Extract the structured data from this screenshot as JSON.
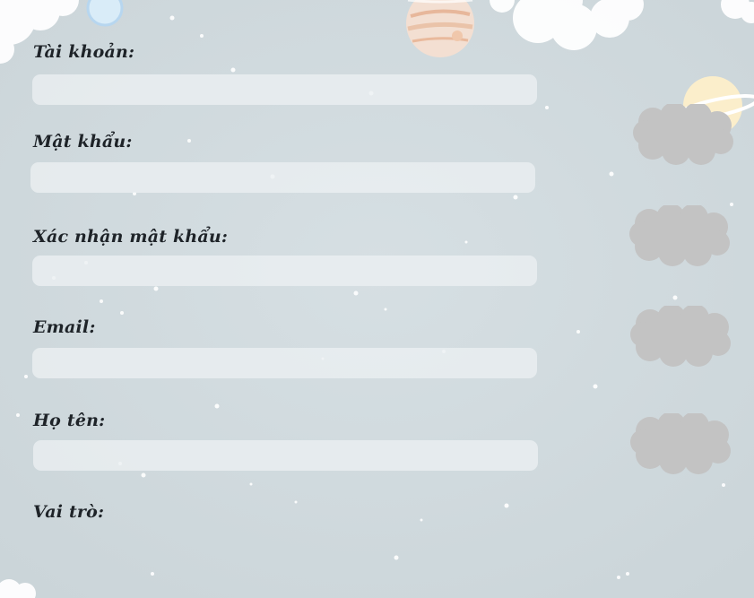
{
  "form": {
    "fields": [
      {
        "label": "Tài khoản:",
        "value": "",
        "placeholder": ""
      },
      {
        "label": "Mật khẩu:",
        "value": "",
        "placeholder": ""
      },
      {
        "label": "Xác nhận mật khẩu:",
        "value": "",
        "placeholder": ""
      },
      {
        "label": "Email:",
        "value": "",
        "placeholder": ""
      },
      {
        "label": "Họ tên:",
        "value": "",
        "placeholder": ""
      }
    ],
    "role_label": "Vai trò:"
  },
  "icons": {
    "side_clouds": [
      "cloud-icon",
      "cloud-icon",
      "cloud-icon",
      "cloud-icon"
    ],
    "decor": [
      "planet-icon",
      "ringed-planet-icon",
      "moon-icon",
      "cloud-icon"
    ]
  },
  "colors": {
    "background": "#d0dade",
    "input_fill": "#eceff1",
    "label_text": "#1e2328",
    "gray_cloud": "#c3c3c3"
  }
}
